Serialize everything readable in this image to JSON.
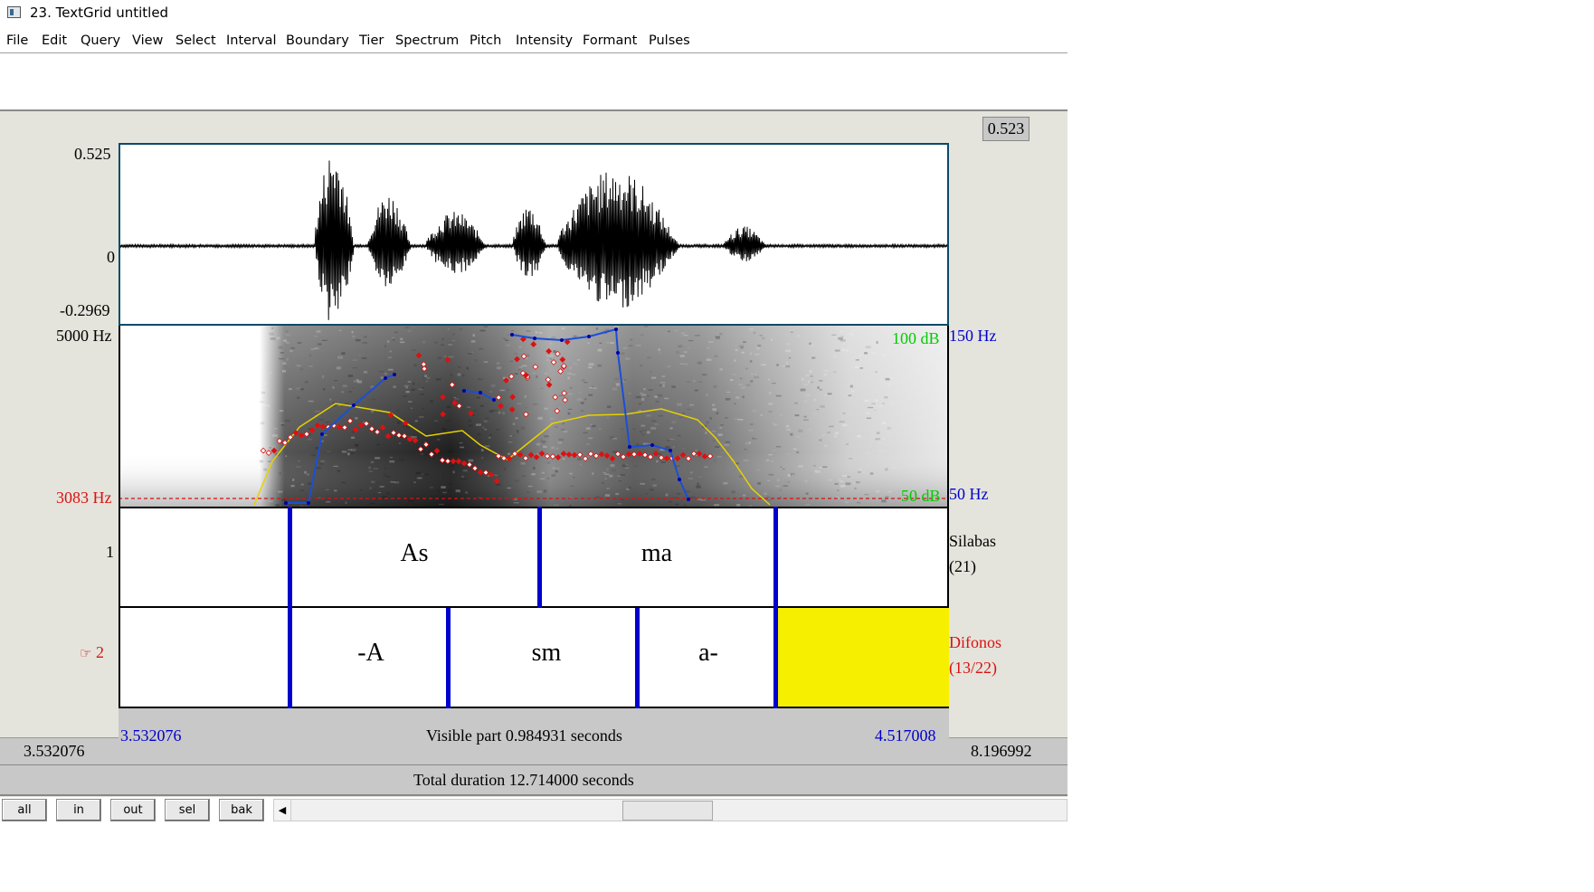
{
  "window": {
    "title": "23. TextGrid untitled"
  },
  "menu": [
    "File",
    "Edit",
    "Query",
    "View",
    "Select",
    "Interval",
    "Boundary",
    "Tier",
    "Spectrum",
    "Pitch",
    "Intensity",
    "Formant",
    "Pulses"
  ],
  "zoom_value": "0.523",
  "waveform": {
    "max_label": "0.525",
    "zero_label": "0",
    "min_label": "-0.2969"
  },
  "spectrogram": {
    "freq_top": "5000 Hz",
    "cursor_freq": "3083 Hz",
    "intensity_top": "100 dB",
    "intensity_bottom": "50 dB",
    "pitch_top": "150 Hz",
    "pitch_bottom": "50 Hz"
  },
  "tiers": [
    {
      "number": "1",
      "name": "Silabas",
      "count": "(21)",
      "intervals": [
        "As",
        "ma"
      ]
    },
    {
      "number": "2",
      "pointer": "☞",
      "name": "Difonos",
      "count": "(13/22)",
      "intervals": [
        "-A",
        "sm",
        "a-"
      ]
    }
  ],
  "time": {
    "visible_start": "3.532076",
    "visible_end": "4.517008",
    "visible_part": "Visible part 0.984931 seconds",
    "left_hidden": "3.532076",
    "right_hidden": "8.196992",
    "total": "Total duration 12.714000 seconds"
  },
  "buttons": {
    "all": "all",
    "in": "in",
    "out": "out",
    "sel": "sel",
    "bak": "bak"
  },
  "colors": {
    "boundary": "#0000cc",
    "pitch": "#1a4fd6",
    "formant": "#dd1111",
    "intensity": "#e6d200",
    "selection": "#f7ef00",
    "db_label": "#00cc00"
  }
}
